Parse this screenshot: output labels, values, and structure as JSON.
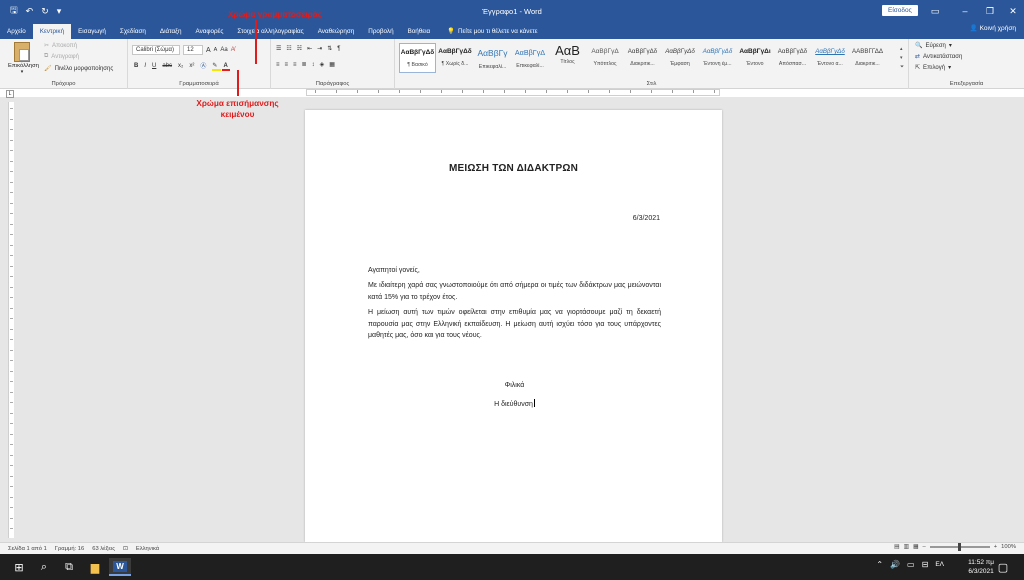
{
  "app": {
    "doc_title": "Έγγραφο1 - Word",
    "signin_label": "Είσοδος",
    "share_label": "Κοινή χρήση",
    "tellme_placeholder": "Πείτε μου τι θέλετε να κάνετε"
  },
  "tabs": [
    "Αρχείο",
    "Κεντρική",
    "Εισαγωγή",
    "Σχεδίαση",
    "Διάταξη",
    "Αναφορές",
    "Στοιχεία αλληλογραφίας",
    "Αναθεώρηση",
    "Προβολή",
    "Βοήθεια"
  ],
  "active_tab": "Κεντρική",
  "ribbon": {
    "clipboard": {
      "label": "Πρόχειρο",
      "paste": "Επικόλληση",
      "cut": "Αποκοπή",
      "copy": "Αντιγραφή",
      "format_painter": "Πινέλο μορφοποίησης"
    },
    "font": {
      "label": "Γραμματοσειρά",
      "font_name": "Calibri (Σώμα)",
      "font_size": "12",
      "bold": "B",
      "italic": "I",
      "underline": "U",
      "strike": "abc",
      "subscript": "x₂",
      "superscript": "x²",
      "case": "Aa",
      "grow": "A",
      "shrink": "A"
    },
    "paragraph": {
      "label": "Παράγραφος"
    },
    "styles": {
      "label": "Στιλ",
      "items": [
        {
          "sample": "ΑαΒβΓγΔδ",
          "name": "¶ Βασικό"
        },
        {
          "sample": "ΑαΒβΓγΔδ",
          "name": "¶ Χωρίς δ..."
        },
        {
          "sample": "ΑαΒβΓγ",
          "name": "Επικεφαλί..."
        },
        {
          "sample": "ΑαΒβΓγΔ",
          "name": "Επικεφαλί..."
        },
        {
          "sample": "ΑαΒ",
          "name": "Τίτλος"
        },
        {
          "sample": "ΑαΒβΓγΔ",
          "name": "Υπότιτλος"
        },
        {
          "sample": "ΑαΒβΓγΔδ",
          "name": "Διακριτικ..."
        },
        {
          "sample": "ΑαΒβΓγΔδ",
          "name": "Έμφαση"
        },
        {
          "sample": "ΑαΒβΓγΔδ",
          "name": "Έντονη έμ..."
        },
        {
          "sample": "ΑαΒβΓγΔι",
          "name": "Έντονο"
        },
        {
          "sample": "ΑαΒβΓγΔδ",
          "name": "Απόσπασ..."
        },
        {
          "sample": "ΑαΒβΓγΔδ",
          "name": "Έντονο α..."
        },
        {
          "sample": "ΑΑΒΒΓΓΔΔ",
          "name": "Διακριτικ..."
        }
      ]
    },
    "editing": {
      "label": "Επεξεργασία",
      "find": "Εύρεση",
      "replace": "Αντικατάσταση",
      "select": "Επιλογή"
    }
  },
  "annotations": {
    "font_color": "Χρώμα γραμματοσειράς",
    "highlight_line1": "Χρώμα επισήμανσης",
    "highlight_line2": "κειμένου"
  },
  "document": {
    "heading": "ΜΕΙΩΣΗ ΤΩΝ ΔΙΔΑΚΤΡΩΝ",
    "date": "6/3/2021",
    "greeting": "Αγαπητοί γονείς,",
    "paragraph1": "Με ιδιαίτερη χαρά σας γνωστοποιούμε ότι από σήμερα οι τιμές των διδάκτρων μας μειώνονται κατά 15% για το τρέχον έτος.",
    "paragraph2": "Η μείωση αυτή των τιμών οφείλεται στην επιθυμία μας να γιορτάσουμε μαζί τη δεκαετή παρουσία μας στην Ελληνική εκπαίδευση. Η μείωση αυτή ισχύει τόσο για τους υπάρχοντες μαθητές μας, όσο και για τους νέους.",
    "closing": "Φιλικά",
    "signature": "Η διεύθυνση"
  },
  "status": {
    "page": "Σελίδα 1 από 1",
    "line": "Γραμμή: 16",
    "words": "63 λέξεις",
    "language": "Ελληνικά",
    "zoom": "100%"
  },
  "taskbar": {
    "time": "11:52 πμ",
    "date": "6/3/2021",
    "lang": "ΕΛ"
  },
  "colors": {
    "word_blue": "#2b579a",
    "annotation_red": "#e01b1b",
    "font_color_bar": "#e81c1c",
    "highlight_bar": "#f5e50a"
  }
}
